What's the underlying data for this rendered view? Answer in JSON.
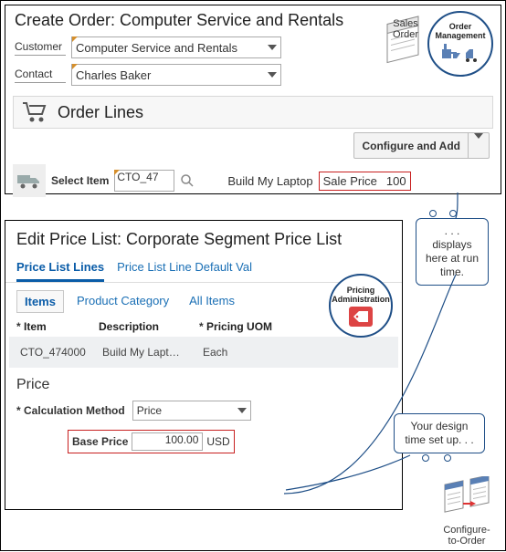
{
  "top": {
    "title": "Create Order: Computer Service and Rentals",
    "customer_label": "Customer",
    "customer_value": "Computer Service and Rentals",
    "contact_label": "Contact",
    "contact_value": "Charles Baker",
    "order_lines_title": "Order Lines",
    "configure_add": "Configure and Add",
    "select_item_label": "Select Item",
    "item_code": "CTO_47",
    "build_label": "Build My Laptop",
    "sale_price_label": "Sale Price",
    "sale_price_value": "100",
    "sales_order": "Sales\nOrder",
    "order_mgmt": "Order\nManagement"
  },
  "bottom": {
    "title": "Edit Price List: Corporate Segment Price List",
    "tabs": {
      "a": "Price List Lines",
      "b": "Price List Line Default Val"
    },
    "subtabs": {
      "items": "Items",
      "prodcat": "Product Category",
      "all": "All Items"
    },
    "cols": {
      "item": "Item",
      "desc": "Description",
      "uom": "Pricing UOM"
    },
    "row": {
      "item": "CTO_474000",
      "desc": "Build My Lapt…",
      "uom": "Each"
    },
    "price_head": "Price",
    "calc_label": "Calculation Method",
    "calc_value": "Price",
    "base_price_label": "Base Price",
    "base_price_value": "100.00",
    "currency": "USD",
    "pricing_badge": "Pricing\nAdministration"
  },
  "callouts": {
    "runtime": ". . . displays here at run time.",
    "design": "Your design time set up. . .",
    "cto": "Configure-\nto-Order"
  }
}
